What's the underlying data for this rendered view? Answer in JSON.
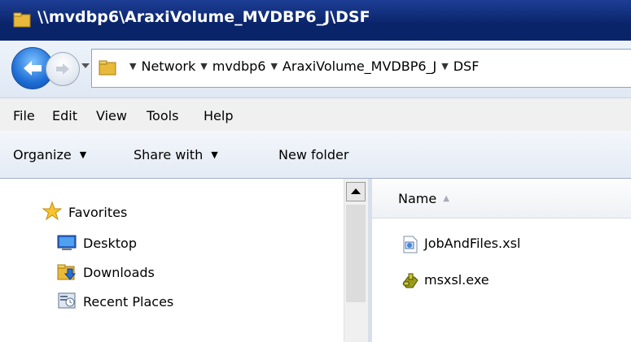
{
  "window": {
    "title": "\\\\mvdbp6\\AraxiVolume_MVDBP6_J\\DSF"
  },
  "address_bar": {
    "breadcrumbs": [
      "Network",
      "mvdbp6",
      "AraxiVolume_MVDBP6_J",
      "DSF"
    ],
    "back_icon": "back-arrow-icon",
    "forward_icon": "forward-arrow-icon"
  },
  "menu": {
    "items": [
      "File",
      "Edit",
      "View",
      "Tools",
      "Help"
    ]
  },
  "command_bar": {
    "organize": "Organize",
    "share_with": "Share with",
    "new_folder": "New folder"
  },
  "nav_pane": {
    "favorites": "Favorites",
    "items": [
      {
        "label": "Desktop",
        "icon": "desktop-icon"
      },
      {
        "label": "Downloads",
        "icon": "downloads-folder-icon"
      },
      {
        "label": "Recent Places",
        "icon": "recent-places-icon"
      }
    ]
  },
  "content": {
    "column_name": "Name",
    "files": [
      {
        "name": "JobAndFiles.xsl",
        "icon": "xsl-file-icon"
      },
      {
        "name": "msxsl.exe",
        "icon": "exe-file-icon"
      }
    ]
  },
  "colors": {
    "title_bar": "#0a246a",
    "accent": "#1f6fd6"
  }
}
